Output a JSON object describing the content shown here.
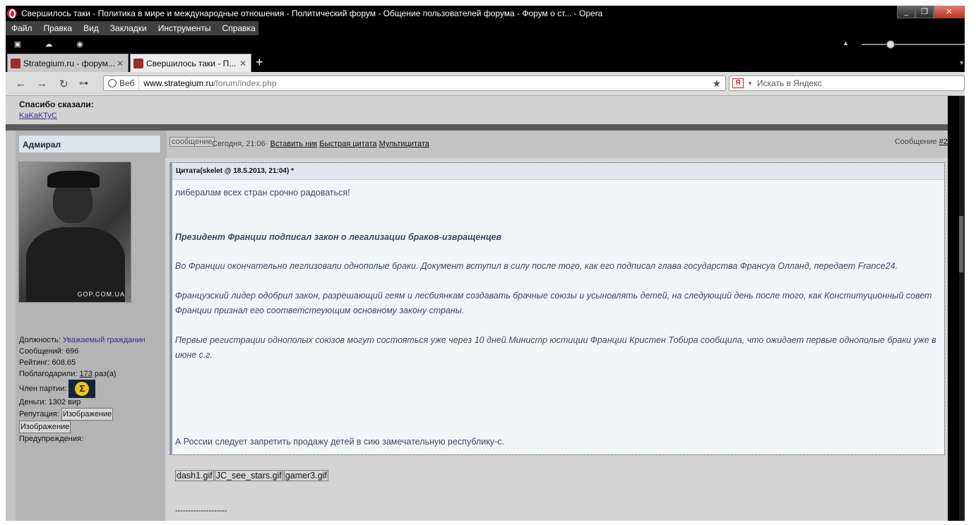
{
  "window": {
    "title": "Свершилось таки - Политика в мире и международные отношения - Политический форум - Общение пользователей форума - Форум о ст... - Opera",
    "controls": [
      "_",
      "❐",
      "✕"
    ]
  },
  "menu": [
    "Файл",
    "Правка",
    "Вид",
    "Закладки",
    "Инструменты",
    "Справка"
  ],
  "tabs": [
    {
      "label": "Strategium.ru - форум...",
      "close": "✕"
    },
    {
      "label": "Свершилось таки - П...",
      "close": "✕"
    }
  ],
  "new_tab": "+",
  "address": {
    "web_badge": "Веб",
    "url_host": "www.strategium.ru",
    "url_path": "/forum/index.php",
    "search_badge": "Я",
    "search_placeholder": "Искать в Яндекс"
  },
  "thanks": {
    "label": "Спасибо сказали:",
    "user": "KaKaKTyC"
  },
  "user": {
    "name": "Адмирал",
    "avatar_mark": "GOP.COM.UA",
    "position_label": "Должность:",
    "position_value": "Уважаемый гражданин",
    "messages": "Сообщений: 696",
    "rating": "Рейтинг: 608.65",
    "thanked_label": "Поблагодарили:",
    "thanked_count": "173",
    "thanked_suffix": "раз(а)",
    "party_label": "Член партии:",
    "party_symbol": "Σ",
    "money": "Деньги: 1302 вир",
    "reputation_label": "Репутация:",
    "image_label": "Изображение",
    "warnings": "Предупреждения:"
  },
  "message": {
    "button": "сообщение",
    "time": "Сегодня, 21:06",
    "separator": "·",
    "insert_nick": "Вставить ник",
    "quick_quote": "Быстрая цитата",
    "multi_quote": "Мультицитата",
    "number_label": "Сообщение",
    "number": "#2"
  },
  "quote": {
    "head": "Цитата(skelet @ 18.5.2013, 21:04)",
    "head_link": "*",
    "lines": [
      "либералам всех стран срочно радоваться!",
      "Президент Франции подписал закон о легализации браков-извращенцев",
      "Во Франции окончательно леглизовали однополые браки. Документ вступил в силу после того, как его подписал глава государства Франсуа Олланд, передает France24.",
      "Французский лидер одобрил закон, разрешающий геям и лесбиянкам создавать брачные союзы и усыновлять детей, на следующий день после того, как Конституционный совет Франции признал его соответстеующим основному закону страны.",
      "Первые регистрации однополых союзов могут состояться уже через 10 дней.Министр юстиции Франции Кристен Тобира сообщила, что ожидает первые однополые браки уже в июне с.г."
    ],
    "final": "А России следует запретить продажу детей в сию замечательную республику-с."
  },
  "attachments": [
    "dash1.gif",
    "JC_see_stars.gif",
    "gamer3.gif"
  ],
  "signature_line": "--------------------"
}
